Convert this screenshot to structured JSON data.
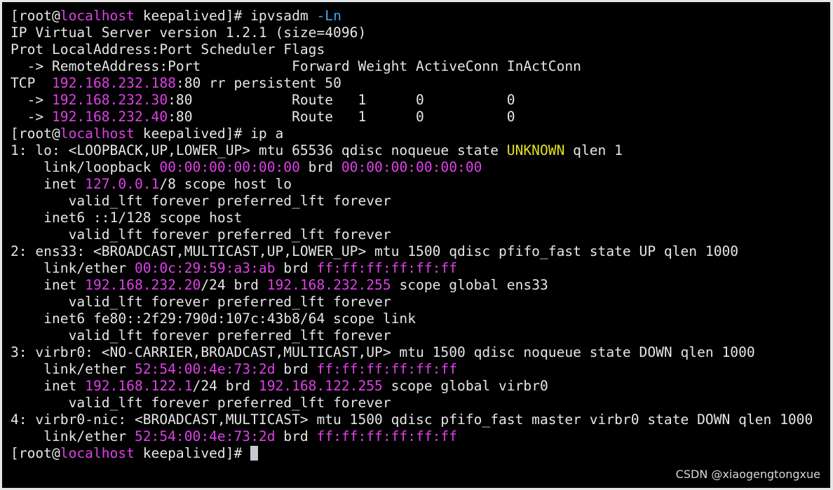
{
  "colors": {
    "background": "#000000",
    "default": "#e6e6e6",
    "magenta": "#e040e8",
    "yellow": "#e0e020",
    "blue": "#40a8f0",
    "cursor": "#c8c8d0",
    "frame": "#e6e6e6"
  },
  "terminal": {
    "lines": [
      [
        {
          "t": "[root@",
          "c": "default"
        },
        {
          "t": "localhost",
          "c": "magenta"
        },
        {
          "t": " keepalived]# ipvsadm ",
          "c": "default"
        },
        {
          "t": "-Ln",
          "c": "blue"
        }
      ],
      [
        {
          "t": "IP Virtual Server version 1.2.1 (size=4096)",
          "c": "default"
        }
      ],
      [
        {
          "t": "Prot LocalAddress:Port Scheduler Flags",
          "c": "default"
        }
      ],
      [
        {
          "t": "  -> RemoteAddress:Port           Forward Weight ActiveConn InActConn",
          "c": "default"
        }
      ],
      [
        {
          "t": "TCP  ",
          "c": "default"
        },
        {
          "t": "192.168.232.188",
          "c": "magenta"
        },
        {
          "t": ":80 rr persistent 50",
          "c": "default"
        }
      ],
      [
        {
          "t": "  -> ",
          "c": "default"
        },
        {
          "t": "192.168.232.30",
          "c": "magenta"
        },
        {
          "t": ":80            Route   1      0          0",
          "c": "default"
        }
      ],
      [
        {
          "t": "  -> ",
          "c": "default"
        },
        {
          "t": "192.168.232.40",
          "c": "magenta"
        },
        {
          "t": ":80            Route   1      0          0",
          "c": "default"
        }
      ],
      [
        {
          "t": "[root@",
          "c": "default"
        },
        {
          "t": "localhost",
          "c": "magenta"
        },
        {
          "t": " keepalived]# ip a",
          "c": "default"
        }
      ],
      [
        {
          "t": "1: lo: <LOOPBACK,UP,LOWER_UP> mtu 65536 qdisc noqueue state ",
          "c": "default"
        },
        {
          "t": "UNKNOWN",
          "c": "yellow"
        },
        {
          "t": " qlen 1",
          "c": "default"
        }
      ],
      [
        {
          "t": "    link/loopback ",
          "c": "default"
        },
        {
          "t": "00:00:00:00:00:00",
          "c": "magenta"
        },
        {
          "t": " brd ",
          "c": "default"
        },
        {
          "t": "00:00:00:00:00:00",
          "c": "magenta"
        }
      ],
      [
        {
          "t": "    inet ",
          "c": "default"
        },
        {
          "t": "127.0.0.1",
          "c": "magenta"
        },
        {
          "t": "/8 scope host lo",
          "c": "default"
        }
      ],
      [
        {
          "t": "       valid_lft forever preferred_lft forever",
          "c": "default"
        }
      ],
      [
        {
          "t": "    inet6 ::1/128 scope host",
          "c": "default"
        }
      ],
      [
        {
          "t": "       valid_lft forever preferred_lft forever",
          "c": "default"
        }
      ],
      [
        {
          "t": "2: ens33: <BROADCAST,MULTICAST,UP,LOWER_UP> mtu 1500 qdisc pfifo_fast state UP qlen 1000",
          "c": "default"
        }
      ],
      [
        {
          "t": "    link/ether ",
          "c": "default"
        },
        {
          "t": "00:0c:29:59:a3:ab",
          "c": "magenta"
        },
        {
          "t": " brd ",
          "c": "default"
        },
        {
          "t": "ff:ff:ff:ff:ff:ff",
          "c": "magenta"
        }
      ],
      [
        {
          "t": "    inet ",
          "c": "default"
        },
        {
          "t": "192.168.232.20",
          "c": "magenta"
        },
        {
          "t": "/24 brd ",
          "c": "default"
        },
        {
          "t": "192.168.232.255",
          "c": "magenta"
        },
        {
          "t": " scope global ens33",
          "c": "default"
        }
      ],
      [
        {
          "t": "       valid_lft forever preferred_lft forever",
          "c": "default"
        }
      ],
      [
        {
          "t": "    inet6 fe80::2f29:790d:107c:43b8/64 scope link",
          "c": "default"
        }
      ],
      [
        {
          "t": "       valid_lft forever preferred_lft forever",
          "c": "default"
        }
      ],
      [
        {
          "t": "3: virbr0: <NO-CARRIER,BROADCAST,MULTICAST,UP> mtu 1500 qdisc noqueue state DOWN qlen 1000",
          "c": "default"
        }
      ],
      [
        {
          "t": "    link/ether ",
          "c": "default"
        },
        {
          "t": "52:54:00:4e:73:2d",
          "c": "magenta"
        },
        {
          "t": " brd ",
          "c": "default"
        },
        {
          "t": "ff:ff:ff:ff:ff:ff",
          "c": "magenta"
        }
      ],
      [
        {
          "t": "    inet ",
          "c": "default"
        },
        {
          "t": "192.168.122.1",
          "c": "magenta"
        },
        {
          "t": "/24 brd ",
          "c": "default"
        },
        {
          "t": "192.168.122.255",
          "c": "magenta"
        },
        {
          "t": " scope global virbr0",
          "c": "default"
        }
      ],
      [
        {
          "t": "       valid_lft forever preferred_lft forever",
          "c": "default"
        }
      ],
      [
        {
          "t": "4: virbr0-nic: <BROADCAST,MULTICAST> mtu 1500 qdisc pfifo_fast master virbr0 state DOWN qlen 1000",
          "c": "default"
        }
      ],
      [
        {
          "t": "    link/ether ",
          "c": "default"
        },
        {
          "t": "52:54:00:4e:73:2d",
          "c": "magenta"
        },
        {
          "t": " brd ",
          "c": "default"
        },
        {
          "t": "ff:ff:ff:ff:ff:ff",
          "c": "magenta"
        }
      ],
      [
        {
          "t": "[root@",
          "c": "default"
        },
        {
          "t": "localhost",
          "c": "magenta"
        },
        {
          "t": " keepalived]# ",
          "c": "default"
        }
      ]
    ]
  },
  "watermark": "CSDN @xiaogengtongxue"
}
